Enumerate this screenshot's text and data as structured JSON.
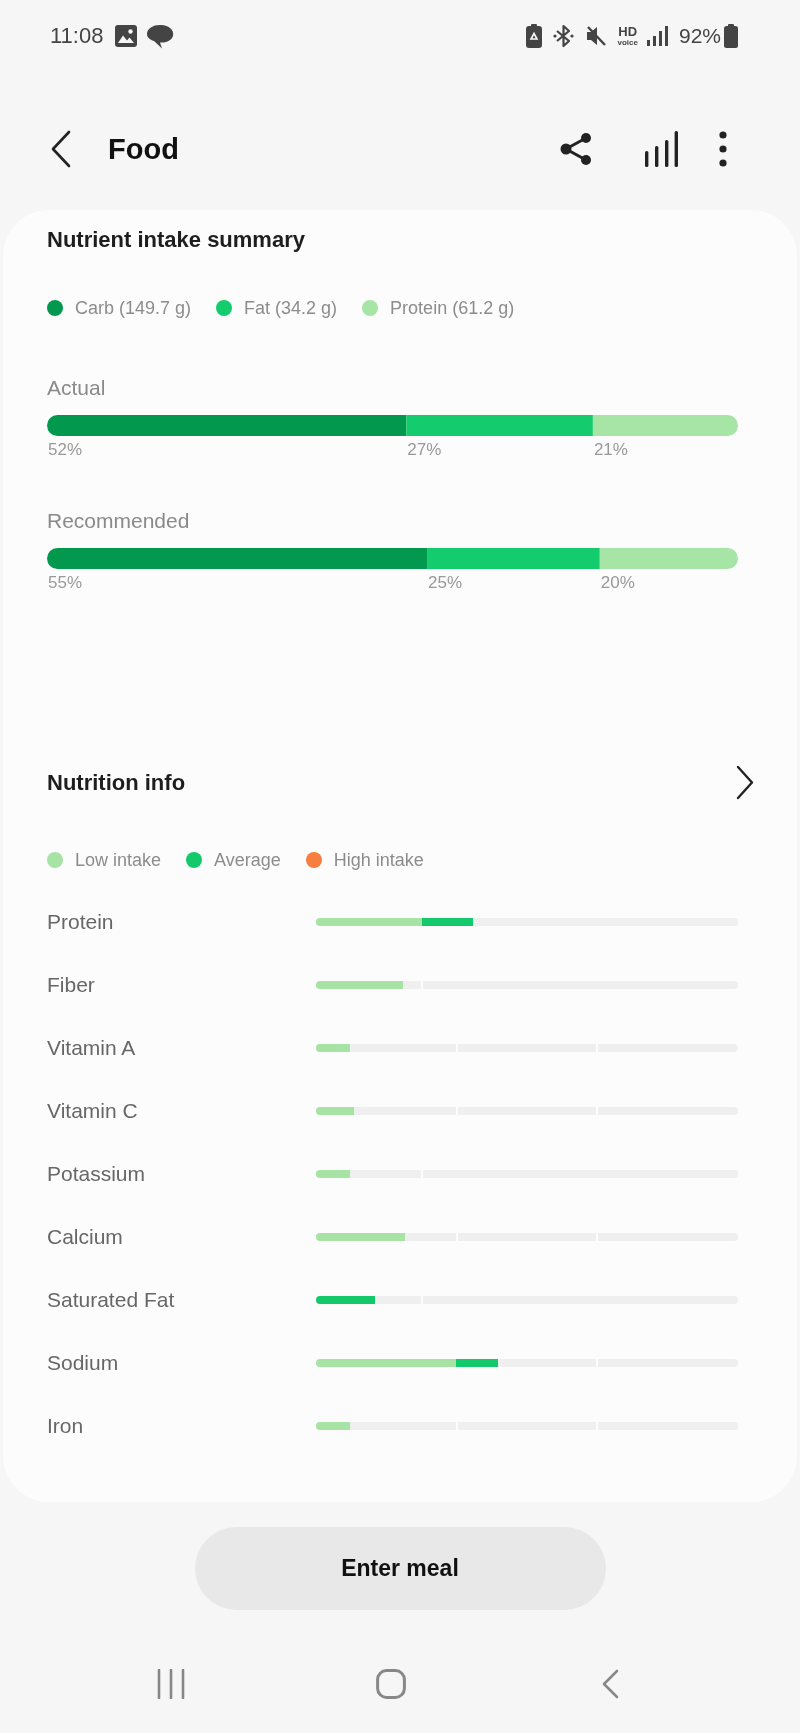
{
  "status_bar": {
    "time": "11:08",
    "hd_voice": [
      "HD",
      "voice"
    ],
    "battery": "92%"
  },
  "header": {
    "title": "Food"
  },
  "summary": {
    "title": "Nutrient intake summary",
    "chart_data": {
      "type": "bar",
      "orientation": "horizontal",
      "stacked": true,
      "legend": "top",
      "categories": [
        "Actual",
        "Recommended"
      ],
      "series": [
        {
          "name": "Carb (149.7 g)",
          "color": "#02994e",
          "values": [
            52,
            55
          ],
          "value_labels": [
            "52%",
            "55%"
          ]
        },
        {
          "name": "Fat (34.2 g)",
          "color": "#14cc6d",
          "values": [
            27,
            25
          ],
          "value_labels": [
            "27%",
            "25%"
          ]
        },
        {
          "name": "Protein (61.2 g)",
          "color": "#a6e5a5",
          "values": [
            21,
            20
          ],
          "value_labels": [
            "21%",
            "20%"
          ]
        }
      ]
    }
  },
  "nutrition": {
    "title": "Nutrition info",
    "legend": [
      {
        "kind": "low",
        "label": "Low intake",
        "color": "#a6e3a4"
      },
      {
        "kind": "average",
        "label": "Average",
        "color": "#14c96b"
      },
      {
        "kind": "high",
        "label": "High intake",
        "color": "#f77e3f"
      }
    ],
    "rows": [
      {
        "name": "Protein",
        "kind": "quarters",
        "level": 0.372,
        "zones": [
          {
            "kind": "low"
          },
          {
            "kind": "average"
          }
        ]
      },
      {
        "name": "Fiber",
        "kind": "quarters",
        "level": 0.207,
        "zones": [
          {
            "kind": "low"
          }
        ]
      },
      {
        "name": "Vitamin A",
        "kind": "thirds",
        "level": 0.08,
        "zones": [
          {
            "kind": "low"
          }
        ]
      },
      {
        "name": "Vitamin C",
        "kind": "thirds",
        "level": 0.089,
        "zones": [
          {
            "kind": "low"
          }
        ]
      },
      {
        "name": "Potassium",
        "kind": "quarters",
        "level": 0.08,
        "zones": [
          {
            "kind": "low"
          }
        ]
      },
      {
        "name": "Calcium",
        "kind": "thirds",
        "level": 0.212,
        "zones": [
          {
            "kind": "low"
          }
        ]
      },
      {
        "name": "Saturated Fat",
        "kind": "quarters",
        "level": 0.139,
        "zones": [
          {
            "kind": "average"
          }
        ]
      },
      {
        "name": "Sodium",
        "kind": "thirds",
        "level": 0.432,
        "zones": [
          {
            "kind": "low"
          },
          {
            "kind": "average"
          }
        ]
      },
      {
        "name": "Iron",
        "kind": "thirds",
        "level": 0.08,
        "zones": [
          {
            "kind": "low"
          }
        ]
      }
    ]
  },
  "button": {
    "label": "Enter meal"
  }
}
